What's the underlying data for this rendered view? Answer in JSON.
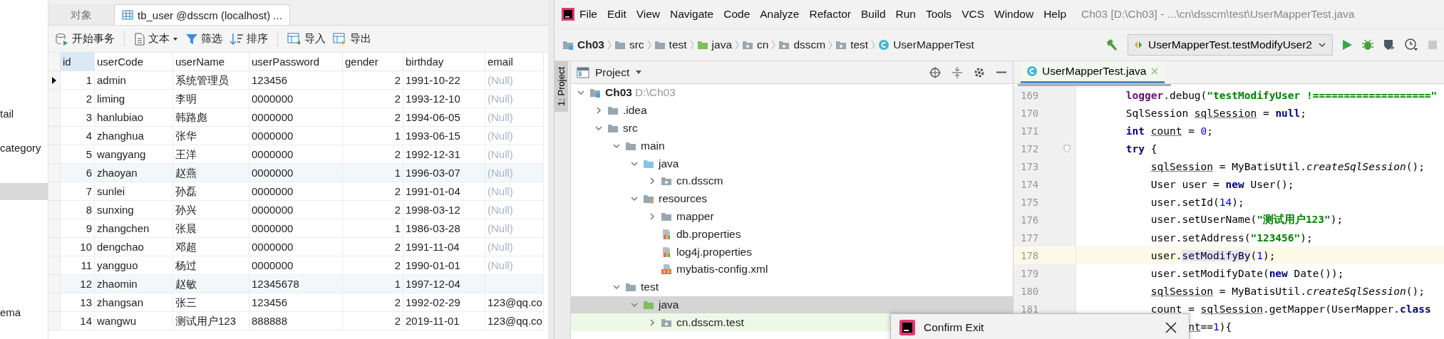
{
  "navicat": {
    "sidebar": [
      {
        "label": "tail",
        "selected": false
      },
      {
        "label": "category",
        "selected": false
      },
      {
        "selected": true
      },
      {
        "label": "ema",
        "selected": false
      }
    ],
    "tabs": [
      {
        "label": "对象",
        "selected": false,
        "kind": "objects"
      },
      {
        "label": "tb_user @dsscm (localhost) ...",
        "selected": true,
        "kind": "table"
      }
    ],
    "toolbar": [
      [
        {
          "label": "开始事务",
          "kind": "transaction"
        }
      ],
      [
        {
          "label": "文本",
          "kind": "text"
        },
        {
          "label": "筛选",
          "kind": "filter"
        },
        {
          "label": "排序",
          "kind": "sort"
        }
      ],
      [
        {
          "label": "导入",
          "kind": "import"
        },
        {
          "label": "导出",
          "kind": "export"
        }
      ]
    ],
    "columns": [
      {
        "label": "id",
        "selected": true
      },
      {
        "label": "userCode",
        "selected": false
      },
      {
        "label": "userName",
        "selected": false
      },
      {
        "label": "userPassword",
        "selected": false
      },
      {
        "label": "gender",
        "selected": false
      },
      {
        "label": "birthday",
        "selected": false
      },
      {
        "label": "email",
        "selected": false
      }
    ],
    "rows": [
      {
        "cells": [
          "1",
          "admin",
          "系统管理员",
          "123456",
          "2",
          "1991-10-22",
          "(Null)"
        ],
        "null_email": true,
        "current": true,
        "highlighted": false
      },
      {
        "cells": [
          "2",
          "liming",
          "李明",
          "0000000",
          "2",
          "1993-12-10",
          "(Null)"
        ],
        "null_email": true,
        "current": false,
        "highlighted": false
      },
      {
        "cells": [
          "3",
          "hanlubiao",
          "韩路彪",
          "0000000",
          "2",
          "1994-06-05",
          "(Null)"
        ],
        "null_email": true,
        "current": false,
        "highlighted": false
      },
      {
        "cells": [
          "4",
          "zhanghua",
          "张华",
          "0000000",
          "1",
          "1993-06-15",
          "(Null)"
        ],
        "null_email": true,
        "current": false,
        "highlighted": false
      },
      {
        "cells": [
          "5",
          "wangyang",
          "王洋",
          "0000000",
          "2",
          "1992-12-31",
          "(Null)"
        ],
        "null_email": true,
        "current": false,
        "highlighted": false
      },
      {
        "cells": [
          "6",
          "zhaoyan",
          "赵燕",
          "0000000",
          "1",
          "1996-03-07",
          "(Null)"
        ],
        "null_email": true,
        "current": false,
        "highlighted": true
      },
      {
        "cells": [
          "7",
          "sunlei",
          "孙磊",
          "0000000",
          "2",
          "1991-01-04",
          "(Null)"
        ],
        "null_email": true,
        "current": false,
        "highlighted": false
      },
      {
        "cells": [
          "8",
          "sunxing",
          "孙兴",
          "0000000",
          "2",
          "1998-03-12",
          "(Null)"
        ],
        "null_email": true,
        "current": false,
        "highlighted": false
      },
      {
        "cells": [
          "9",
          "zhangchen",
          "张晨",
          "0000000",
          "1",
          "1986-03-28",
          "(Null)"
        ],
        "null_email": true,
        "current": false,
        "highlighted": false
      },
      {
        "cells": [
          "10",
          "dengchao",
          "邓超",
          "0000000",
          "2",
          "1991-11-04",
          "(Null)"
        ],
        "null_email": true,
        "current": false,
        "highlighted": false
      },
      {
        "cells": [
          "11",
          "yangguo",
          "杨过",
          "0000000",
          "2",
          "1990-01-01",
          "(Null)"
        ],
        "null_email": true,
        "current": false,
        "highlighted": false
      },
      {
        "cells": [
          "12",
          "zhaomin",
          "赵敏",
          "12345678",
          "1",
          "1997-12-04"
        ],
        "null_email": false,
        "current": false,
        "highlighted": true
      },
      {
        "cells": [
          "13",
          "zhangsan",
          "张三",
          "123456",
          "2",
          "1992-02-29",
          "123@qq.co"
        ],
        "null_email": false,
        "current": false,
        "highlighted": false
      },
      {
        "cells": [
          "14",
          "wangwu",
          "测试用户123",
          "888888",
          "2",
          "2019-11-01",
          "123@qq.co"
        ],
        "null_email": false,
        "current": false,
        "highlighted": false
      }
    ]
  },
  "ide": {
    "menu": [
      "File",
      "Edit",
      "View",
      "Navigate",
      "Code",
      "Analyze",
      "Refactor",
      "Build",
      "Run",
      "Tools",
      "VCS",
      "Window",
      "Help"
    ],
    "title": "Ch03 [D:\\Ch03] - ...\\cn\\dsscm\\test\\UserMapperTest.java",
    "breadcrumbs": [
      {
        "label": "Ch03",
        "kind": "module"
      },
      {
        "label": "src",
        "kind": "folder"
      },
      {
        "label": "test",
        "kind": "folder"
      },
      {
        "label": "java",
        "kind": "test-source"
      },
      {
        "label": "cn",
        "kind": "package"
      },
      {
        "label": "dsscm",
        "kind": "package"
      },
      {
        "label": "test",
        "kind": "package"
      },
      {
        "label": "UserMapperTest",
        "kind": "class"
      }
    ],
    "run_config": "UserMapperTest.testModifyUser2",
    "run_actions": [
      {
        "kind": "build"
      },
      {
        "kind": "run"
      },
      {
        "kind": "debug"
      },
      {
        "kind": "coverage"
      },
      {
        "kind": "profile"
      },
      {
        "kind": "stop"
      }
    ],
    "side_stripe": "1: Project",
    "panel_title": "Project",
    "tree": [
      {
        "label": "Ch03",
        "hint": "D:\\Ch03",
        "kind": "module",
        "expanded": true,
        "selected": false,
        "children": [
          {
            "label": ".idea",
            "kind": "folder",
            "expanded": false,
            "selected": false
          },
          {
            "label": "src",
            "kind": "folder",
            "expanded": true,
            "selected": false,
            "children": [
              {
                "label": "main",
                "kind": "folder",
                "expanded": true,
                "selected": false,
                "children": [
                  {
                    "label": "java",
                    "kind": "source",
                    "expanded": true,
                    "selected": false,
                    "children": [
                      {
                        "label": "cn.dsscm",
                        "kind": "package",
                        "expanded": false,
                        "selected": false
                      }
                    ]
                  },
                  {
                    "label": "resources",
                    "kind": "resources",
                    "expanded": true,
                    "selected": false,
                    "children": [
                      {
                        "label": "mapper",
                        "kind": "folder",
                        "expanded": false,
                        "selected": false
                      },
                      {
                        "label": "db.properties",
                        "kind": "properties",
                        "selected": false
                      },
                      {
                        "label": "log4j.properties",
                        "kind": "properties",
                        "selected": false
                      },
                      {
                        "label": "mybatis-config.xml",
                        "kind": "xml",
                        "selected": false
                      }
                    ]
                  }
                ]
              },
              {
                "label": "test",
                "kind": "folder",
                "expanded": true,
                "selected": false,
                "children": [
                  {
                    "label": "java",
                    "kind": "test-source",
                    "expanded": true,
                    "selected": true,
                    "children": [
                      {
                        "label": "cn.dsscm.test",
                        "kind": "package",
                        "expanded": false,
                        "selected": false
                      }
                    ]
                  }
                ]
              }
            ]
          }
        ]
      }
    ],
    "editor_tab": {
      "label": "UserMapperTest.java",
      "selected": true
    },
    "code": [
      {
        "number": "169",
        "current": false,
        "segments": [
          {
            "kind": "field",
            "text": "logger"
          },
          {
            "kind": "plain",
            "text": ".debug("
          },
          {
            "kind": "string",
            "text": "\"testModifyUser !===================\""
          }
        ]
      },
      {
        "number": "170",
        "current": false,
        "segments": [
          {
            "kind": "plain",
            "text": "SqlSession "
          },
          {
            "kind": "var",
            "text": "sqlSession"
          },
          {
            "kind": "plain",
            "text": " = "
          },
          {
            "kind": "keyword",
            "text": "null"
          },
          {
            "kind": "plain",
            "text": ";"
          }
        ]
      },
      {
        "number": "171",
        "current": false,
        "segments": [
          {
            "kind": "keyword",
            "text": "int"
          },
          {
            "kind": "var",
            "text": "count",
            "gap": true
          },
          {
            "kind": "plain",
            "text": " = "
          },
          {
            "kind": "number",
            "text": "0"
          },
          {
            "kind": "plain",
            "text": ";"
          }
        ]
      },
      {
        "number": "172",
        "current": false,
        "segments": [
          {
            "kind": "keyword",
            "text": "try"
          },
          {
            "kind": "plain",
            "text": " {"
          }
        ],
        "children": [
          {
            "number": "173",
            "current": false,
            "segments": [
              {
                "kind": "var",
                "text": "sqlSession"
              },
              {
                "kind": "plain",
                "text": " = MyBatisUtil."
              },
              {
                "kind": "static",
                "text": "createSqlSession"
              },
              {
                "kind": "plain",
                "text": "();"
              }
            ]
          },
          {
            "number": "174",
            "current": false,
            "segments": [
              {
                "kind": "plain",
                "text": "User user = "
              },
              {
                "kind": "keyword",
                "text": "new"
              },
              {
                "kind": "plain",
                "text": " User();"
              }
            ]
          },
          {
            "number": "175",
            "current": false,
            "segments": [
              {
                "kind": "plain",
                "text": "user.setId("
              },
              {
                "kind": "number",
                "text": "14"
              },
              {
                "kind": "plain",
                "text": ");"
              }
            ]
          },
          {
            "number": "176",
            "current": false,
            "segments": [
              {
                "kind": "plain",
                "text": "user.setUserName("
              },
              {
                "kind": "string",
                "text": "\"测试用户123\""
              },
              {
                "kind": "plain",
                "text": ");"
              }
            ]
          },
          {
            "number": "177",
            "current": false,
            "segments": [
              {
                "kind": "plain",
                "text": "user.setAddress("
              },
              {
                "kind": "string",
                "text": "\"123456\""
              },
              {
                "kind": "plain",
                "text": ");"
              }
            ]
          },
          {
            "number": "178",
            "current": true,
            "segments": [
              {
                "kind": "plain",
                "text": "user."
              },
              {
                "kind": "selected",
                "text": "setModifyBy"
              },
              {
                "kind": "plain",
                "text": "("
              },
              {
                "kind": "number",
                "text": "1"
              },
              {
                "kind": "plain",
                "text": ");"
              }
            ]
          },
          {
            "number": "179",
            "current": false,
            "segments": [
              {
                "kind": "plain",
                "text": "user.setModifyDate("
              },
              {
                "kind": "keyword",
                "text": "new"
              },
              {
                "kind": "plain",
                "text": " Date());"
              }
            ]
          },
          {
            "number": "180",
            "current": false,
            "segments": [
              {
                "kind": "var",
                "text": "sqlSession"
              },
              {
                "kind": "plain",
                "text": " = MyBatisUtil."
              },
              {
                "kind": "static",
                "text": "createSqlSession"
              },
              {
                "kind": "plain",
                "text": "();"
              }
            ]
          },
          {
            "number": "181",
            "current": false,
            "segments": [
              {
                "kind": "var",
                "text": "count"
              },
              {
                "kind": "plain",
                "text": " = "
              },
              {
                "kind": "var",
                "text": "sqlSession"
              },
              {
                "kind": "plain",
                "text": ".getMapper(UserMapper."
              },
              {
                "kind": "keyword",
                "text": "class"
              }
            ]
          },
          {
            "current": false,
            "covered": true,
            "segments": [
              {
                "kind": "var",
                "text": "nt"
              },
              {
                "kind": "plain",
                "text": "=="
              },
              {
                "kind": "number",
                "text": "1"
              },
              {
                "kind": "plain",
                "text": "){"
              }
            ]
          }
        ]
      }
    ],
    "dialog": {
      "title": "Confirm Exit"
    }
  }
}
